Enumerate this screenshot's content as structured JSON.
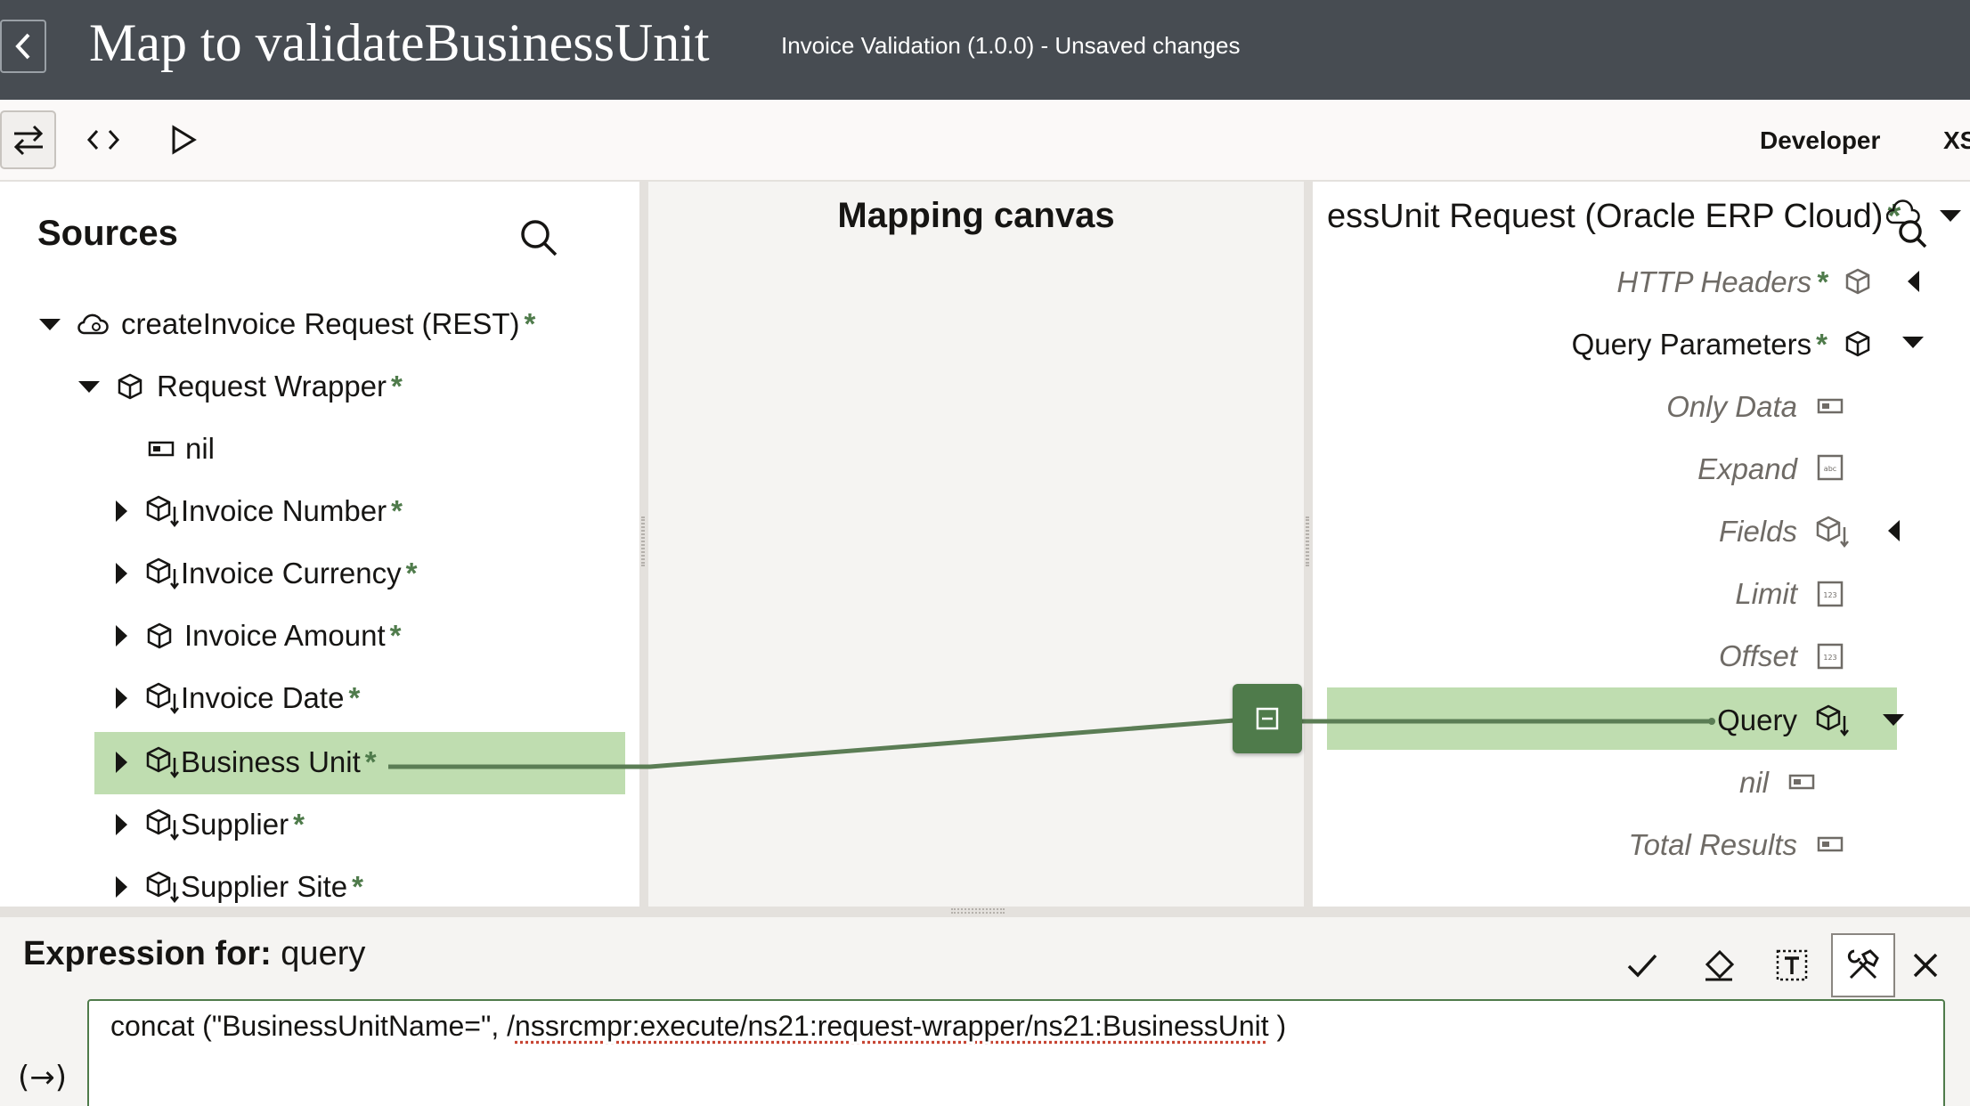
{
  "header": {
    "title": "Map to validateBusinessUnit",
    "subtitle": "Invoice Validation (1.0.0) - Unsaved changes"
  },
  "toolbar": {
    "developer_label": "Developer",
    "xslt_label": "XS"
  },
  "sources": {
    "title": "Sources",
    "root": "createInvoice Request (REST)",
    "wrapper": "Request Wrapper",
    "items": [
      {
        "label": "nil",
        "required": false
      },
      {
        "label": "Invoice Number",
        "required": true
      },
      {
        "label": "Invoice Currency",
        "required": true
      },
      {
        "label": "Invoice Amount",
        "required": true
      },
      {
        "label": "Invoice Date",
        "required": true
      },
      {
        "label": "Business Unit",
        "required": true
      },
      {
        "label": "Supplier",
        "required": true
      },
      {
        "label": "Supplier Site",
        "required": true
      }
    ]
  },
  "canvas": {
    "title": "Mapping canvas"
  },
  "target": {
    "title": "essUnit Request (Oracle ERP Cloud)",
    "items": [
      {
        "label": "HTTP Headers"
      },
      {
        "label": "Query Parameters"
      },
      {
        "label": "Only Data"
      },
      {
        "label": "Expand"
      },
      {
        "label": "Fields"
      },
      {
        "label": "Limit"
      },
      {
        "label": "Offset"
      },
      {
        "label": "Query"
      },
      {
        "label": "nil"
      },
      {
        "label": "Total Results"
      }
    ]
  },
  "expression": {
    "title_prefix": "Expression for:",
    "field": "query",
    "code_prefix": "concat (\"BusinessUnitName=\", /",
    "code_path": "nssrcmpr:execute/ns21:request-wrapper/ns21:BusinessUnit",
    "code_suffix": " )"
  },
  "colors": {
    "header_bg": "#474c52",
    "accent_green": "#4f7b4b",
    "highlight_green": "#bfddb0",
    "mapping_line": "#5b7d55"
  }
}
